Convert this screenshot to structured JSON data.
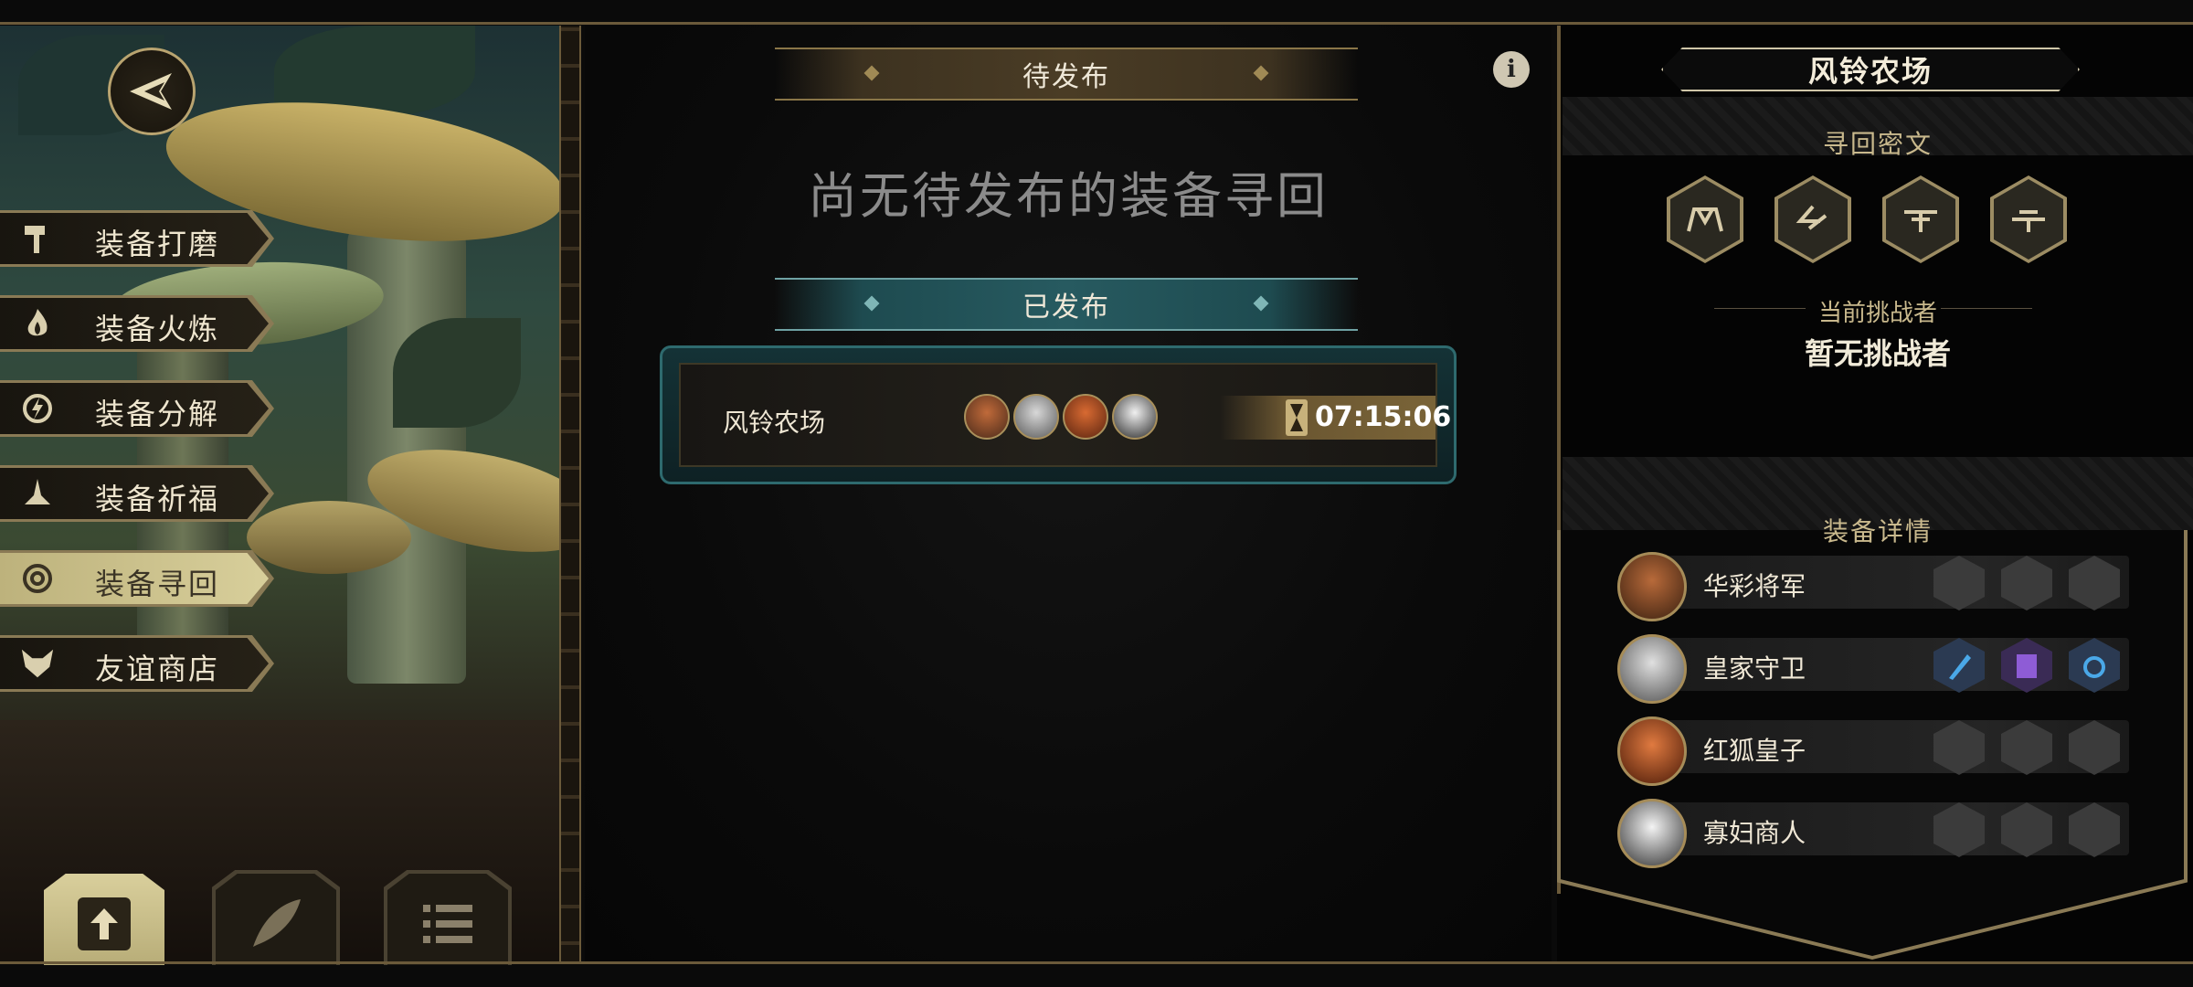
{
  "left_menu": {
    "items": [
      {
        "label": "装备打磨",
        "icon": "hammer-icon"
      },
      {
        "label": "装备火炼",
        "icon": "flame-icon"
      },
      {
        "label": "装备分解",
        "icon": "decompose-icon"
      },
      {
        "label": "装备祈福",
        "icon": "praying-hands-icon"
      },
      {
        "label": "装备寻回",
        "icon": "target-icon",
        "active": true
      },
      {
        "label": "友谊商店",
        "icon": "fox-head-icon"
      }
    ],
    "bottom_tabs": [
      "upload-icon",
      "feather-icon",
      "list-icon"
    ]
  },
  "center": {
    "pending_header": "待发布",
    "empty_message": "尚无待发布的装备寻回",
    "published_header": "已发布",
    "published_entry": {
      "location": "风铃农场",
      "timer": "07:15:06"
    }
  },
  "right": {
    "title": "风铃农场",
    "cipher_header": "寻回密文",
    "challenger_label": "当前挑战者",
    "challenger_value": "暂无挑战者",
    "equipment_header": "装备详情",
    "heroes": [
      {
        "name": "华彩将军",
        "slots_filled": [
          false,
          false,
          false
        ]
      },
      {
        "name": "皇家守卫",
        "slots_filled": [
          true,
          true,
          true
        ]
      },
      {
        "name": "红狐皇子",
        "slots_filled": [
          false,
          false,
          false
        ]
      },
      {
        "name": "寡妇商人",
        "slots_filled": [
          false,
          false,
          false
        ]
      }
    ]
  },
  "colors": {
    "gold": "#b9a470",
    "teal": "#2e6a6e",
    "accent_blue": "#4aa8e8",
    "accent_purple": "#8e5cd6"
  }
}
